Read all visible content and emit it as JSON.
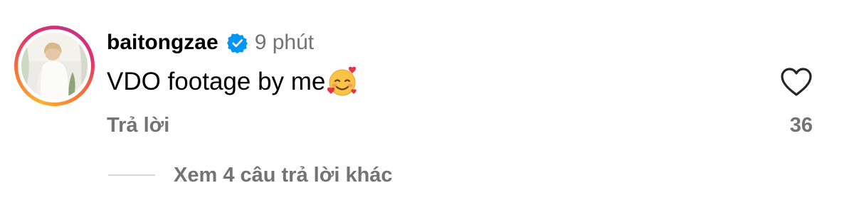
{
  "comment": {
    "username": "baitongzae",
    "verified": true,
    "timestamp": "9 phút",
    "text": "VDO footage by me",
    "text_emoji": "smiling-face-with-hearts",
    "reply_label": "Trả lời",
    "like_count": "36",
    "view_replies_label": "Xem 4 câu trả lời khác"
  },
  "icons": {
    "verified": "verified-badge-icon",
    "like": "heart-outline-icon"
  },
  "colors": {
    "verified_blue": "#0095f6",
    "secondary_text": "#737373",
    "story_ring_start": "#fbb12d",
    "story_ring_end": "#c13584"
  }
}
